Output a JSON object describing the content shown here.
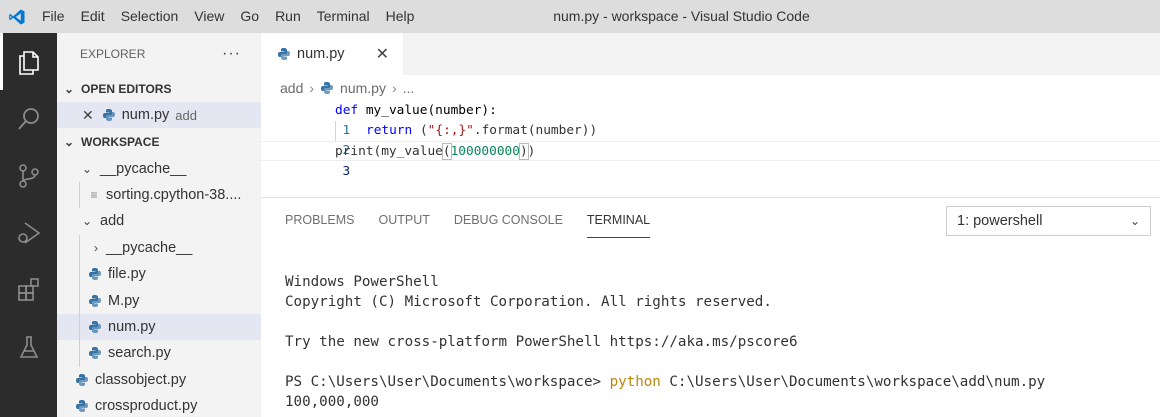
{
  "titlebar": {
    "menu": [
      "File",
      "Edit",
      "Selection",
      "View",
      "Go",
      "Run",
      "Terminal",
      "Help"
    ],
    "title": "num.py - workspace - Visual Studio Code"
  },
  "activitybar": {
    "items": [
      "explorer-icon",
      "search-icon",
      "source-control-icon",
      "run-debug-icon",
      "extensions-icon",
      "testing-icon"
    ]
  },
  "sidebar": {
    "header": "EXPLORER",
    "more": "···",
    "open_editors": {
      "label": "OPEN EDITORS",
      "items": [
        {
          "name": "num.py",
          "hint": "add"
        }
      ]
    },
    "workspace": {
      "label": "WORKSPACE",
      "pycache": "__pycache__",
      "pycache_file": "sorting.cpython-38....",
      "add_folder": "add",
      "add_pycache": "__pycache__",
      "add_files": [
        "file.py",
        "M.py",
        "num.py",
        "search.py"
      ],
      "root_files": [
        "classobject.py",
        "crossproduct.py"
      ]
    }
  },
  "editor": {
    "tab_label": "num.py",
    "breadcrumb": {
      "folder": "add",
      "file": "num.py",
      "more": "..."
    },
    "lines": [
      {
        "num": "1",
        "text": "def my_value(number):"
      },
      {
        "num": "2",
        "text": "    return (\"{:,}\".format(number))"
      },
      {
        "num": "3",
        "text": "print(my_value(100000000))"
      }
    ],
    "line1": {
      "def": "def",
      "rest": " my_value(number):"
    },
    "line2": {
      "ret": "return",
      "open": " (",
      "str": "\"{:,}\"",
      "rest": ".format(number))"
    },
    "line3": {
      "pre": "print(my_value",
      "open": "(",
      "num": "100000000",
      "close": ")",
      "end": ")"
    }
  },
  "panel": {
    "tabs": [
      "PROBLEMS",
      "OUTPUT",
      "DEBUG CONSOLE",
      "TERMINAL"
    ],
    "active_tab": "TERMINAL",
    "terminal_select": "1: powershell",
    "terminal": {
      "l1": "Windows PowerShell",
      "l2": "Copyright (C) Microsoft Corporation. All rights reserved.",
      "l3": "Try the new cross-platform PowerShell https://aka.ms/pscore6",
      "prompt": "PS C:\\Users\\User\\Documents\\workspace> ",
      "cmd": "python",
      "args": " C:\\Users\\User\\Documents\\workspace\\add\\num.py",
      "output": "100,000,000"
    }
  },
  "colors": {
    "activitybar": "#2c2c2c",
    "sidebar": "#f3f3f3",
    "titlebar": "#dddddd",
    "accent": "#007acc"
  }
}
